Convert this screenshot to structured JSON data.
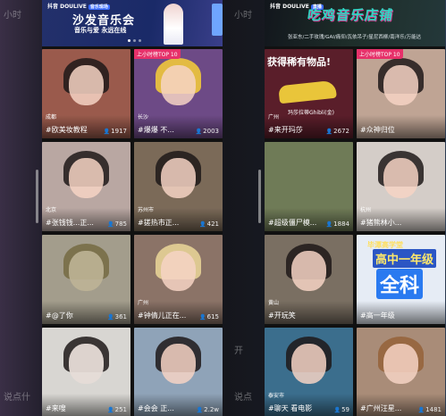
{
  "bg": {
    "left": [
      "小时",
      "说点什"
    ],
    "right": [
      "小时",
      "开",
      "说点"
    ]
  },
  "left": {
    "banner": {
      "brand": "抖音 DOULIVE",
      "tag": "音乐现场",
      "title": "沙发音乐会",
      "subtitle": "音乐与爱 永远在线",
      "accent": "#3b6cff"
    },
    "tiles": [
      {
        "city": "成都",
        "caption": "#欧美妆教程",
        "count": "1917",
        "badge": "",
        "bg": "#9a5a4c"
      },
      {
        "city": "长沙",
        "caption": "#爆爆 不...",
        "count": "2003",
        "badge": "上小时榜TOP 10",
        "bg": "#6d4a86"
      },
      {
        "city": "北京",
        "caption": "#张钱钱...正...",
        "count": "785",
        "badge": "",
        "bg": "#b9a7a2"
      },
      {
        "city": "苏州市",
        "caption": "#搓热市正...",
        "count": "421",
        "badge": "",
        "bg": "#7b6a58"
      },
      {
        "city": "",
        "caption": "#@了你",
        "count": "361",
        "badge": "",
        "bg": "#a39d8c"
      },
      {
        "city": "广州",
        "caption": "#钟倩儿正在...",
        "count": "615",
        "badge": "",
        "bg": "#8b7367"
      },
      {
        "city": "",
        "caption": "#来嗖",
        "count": "251",
        "badge": "",
        "bg": "#d8d6d2"
      },
      {
        "city": "",
        "caption": "#会会 正...",
        "count": "2.2w",
        "badge": "",
        "bg": "#8fa3b8"
      }
    ]
  },
  "right": {
    "banner": {
      "brand": "抖音 DOULIVE",
      "tag": "直播",
      "title": "吃鸡音乐店铺",
      "info": "张亚东/二手玫瑰/GAI/痛仰/瓦依吊子/星尼西柳/南洋乐/万能达",
      "accent": "#2fd6c4"
    },
    "tiles": [
      {
        "city": "广州",
        "caption": "#来开玛莎",
        "count": "2672",
        "badge": "",
        "title": "获得稀有物品!",
        "label": "玛莎拉蒂Ghibli(金)",
        "bg": "#5a1e2a"
      },
      {
        "city": "",
        "caption": "#众神归位",
        "count": "",
        "badge": "上小时榜TOP 10",
        "bg": "#bfa494"
      },
      {
        "city": "",
        "caption": "#超级僵尸模...",
        "count": "1884",
        "badge": "",
        "bg": "#6f7b57"
      },
      {
        "city": "杭州",
        "caption": "#猪熊林小...",
        "count": "",
        "badge": "",
        "bg": "#d4cdc8"
      },
      {
        "city": "黄山",
        "caption": "#开玩笑",
        "count": "",
        "badge": "",
        "bg": "#7a6f62"
      },
      {
        "city": "",
        "caption": "#高一年级",
        "count": "",
        "badge": "",
        "sub": "毕潭高学堂",
        "big": "高中一年级",
        "huge": "全科",
        "bg": "#e6ecf5"
      },
      {
        "city": "泰安市",
        "caption": "#聊天 看电影",
        "count": "59",
        "badge": "",
        "bg": "#3b6e8d"
      },
      {
        "city": "",
        "caption": "#广州汪星...",
        "count": "1481",
        "badge": "",
        "bg": "#a98c78"
      }
    ]
  }
}
